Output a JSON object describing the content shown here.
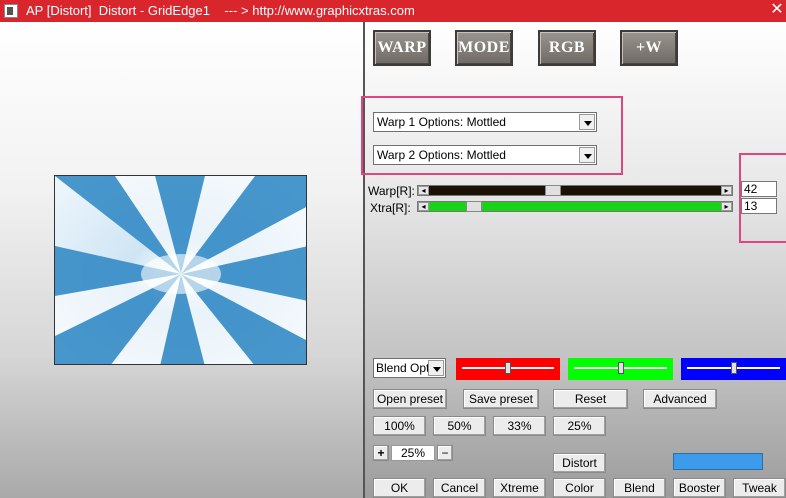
{
  "window": {
    "title": "AP [Distort]  Distort - GridEdge1    --- > http://www.graphicxtras.com",
    "close_glyph": "✕"
  },
  "top_buttons": [
    "WARP",
    "MODE",
    "RGB",
    "+W"
  ],
  "warp1": {
    "value": "Warp 1 Options: Mottled"
  },
  "warp2": {
    "value": "Warp 2 Options: Mottled"
  },
  "sliders": [
    {
      "label": "Warp[R]:",
      "value": "42",
      "fraction": 0.42,
      "color": "#1a1204"
    },
    {
      "label": "Xtra[R]:",
      "value": "13",
      "fraction": 0.13,
      "color": "#19d319"
    }
  ],
  "blend": {
    "value": "Blend Optio"
  },
  "rgb_controls": [
    {
      "name": "red",
      "color": "#ff0000",
      "fraction": 0.5
    },
    {
      "name": "green",
      "color": "#00ff00",
      "fraction": 0.5
    },
    {
      "name": "blue",
      "color": "#0000ff",
      "fraction": 0.5
    }
  ],
  "preset_buttons": [
    "Open preset",
    "Save preset",
    "Reset",
    "Advanced"
  ],
  "zoom_buttons": [
    "100%",
    "50%",
    "33%",
    "25%"
  ],
  "zoom_stepper": {
    "plus": "+",
    "value": "25%",
    "minus": "−"
  },
  "distort_button": "Distort",
  "bottom_buttons": [
    "OK",
    "Cancel",
    "Xtreme",
    "Color",
    "Blend",
    "Booster",
    "Tweak"
  ],
  "colors": {
    "title_bar": "#d9262d",
    "highlight": "#e0457f",
    "swatch": "#3c9bea",
    "preview_blue": "#2b86c4"
  }
}
